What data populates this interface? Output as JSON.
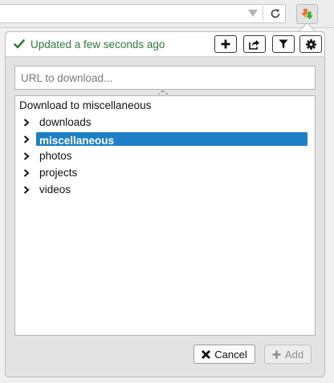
{
  "toolbar": {
    "dropdown_icon": "dropdown-triangle-icon",
    "reload_icon": "reload-icon",
    "extension_icon": "download-arrow-icon"
  },
  "header": {
    "status_text": "Updated a few seconds ago",
    "status_icon": "checkmark-icon",
    "status_color": "#2f7a38",
    "buttons": [
      {
        "name": "add",
        "icon": "plus-icon"
      },
      {
        "name": "share",
        "icon": "share-icon"
      },
      {
        "name": "filter",
        "icon": "filter-icon"
      },
      {
        "name": "settings",
        "icon": "gear-icon"
      }
    ]
  },
  "url_input": {
    "placeholder": "URL to download...",
    "value": ""
  },
  "tree": {
    "title": "Download to miscellaneous",
    "folders": [
      {
        "label": "downloads",
        "selected": false
      },
      {
        "label": "miscellaneous",
        "selected": true
      },
      {
        "label": "photos",
        "selected": false
      },
      {
        "label": "projects",
        "selected": false
      },
      {
        "label": "videos",
        "selected": false
      }
    ],
    "selected_color": "#1e7fc5"
  },
  "footer": {
    "cancel_label": "Cancel",
    "cancel_icon": "close-icon",
    "add_label": "Add",
    "add_icon": "plus-icon",
    "add_disabled": true
  }
}
